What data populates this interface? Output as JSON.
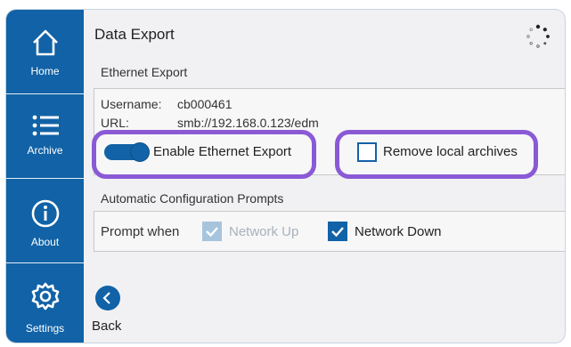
{
  "sidebar": {
    "items": [
      {
        "label": "Home",
        "icon": "home-icon"
      },
      {
        "label": "Archive",
        "icon": "list-icon"
      },
      {
        "label": "About",
        "icon": "info-icon"
      },
      {
        "label": "Settings",
        "icon": "gear-icon"
      }
    ]
  },
  "header": {
    "title": "Data Export"
  },
  "ethernet": {
    "section_label": "Ethernet Export",
    "username_label": "Username:",
    "username_value": "cb000461",
    "url_label": "URL:",
    "url_value": "smb://192.168.0.123/edm",
    "enable_label": "Enable Ethernet Export",
    "enable_on": true,
    "remove_label": "Remove local archives",
    "remove_checked": false
  },
  "auto_config": {
    "section_label": "Automatic Configuration Prompts",
    "prompt_label": "Prompt when",
    "network_up_label": "Network Up",
    "network_up_checked": true,
    "network_up_disabled": true,
    "network_down_label": "Network Down",
    "network_down_checked": true
  },
  "footer": {
    "back_label": "Back"
  },
  "colors": {
    "accent": "#1162a6",
    "highlight": "#8a5ad6",
    "background": "#f1f1f3"
  }
}
